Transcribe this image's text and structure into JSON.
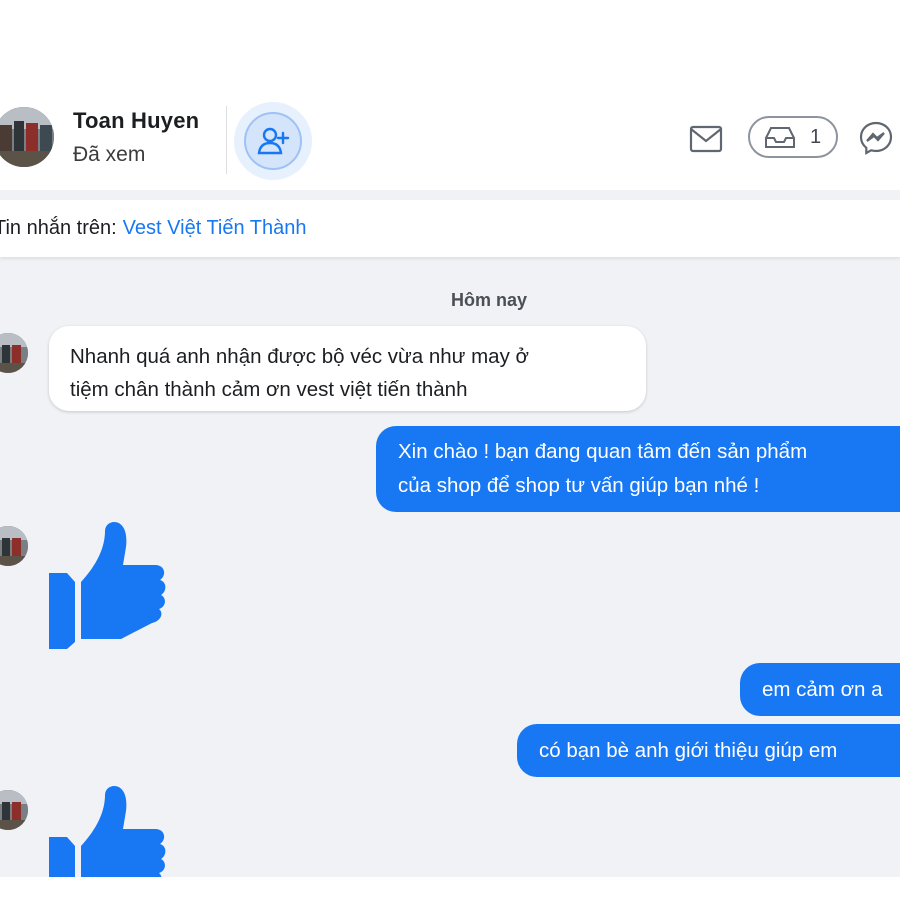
{
  "header": {
    "contact_name": "Toan Huyen",
    "status": "Đã xem",
    "inbox_count": "1"
  },
  "source": {
    "label": "Tin nhắn trên:",
    "page_name": "Vest Việt Tiến Thành"
  },
  "thread": {
    "day_separator": "Hôm nay",
    "messages": [
      {
        "from": "customer",
        "lines": [
          "Nhanh quá anh nhận được bộ véc vừa như may ở",
          "tiệm chân thành cảm ơn vest việt tiến thành"
        ]
      },
      {
        "from": "page",
        "lines": [
          "Xin chào ! bạn đang quan tâm đến sản phẩm",
          "của shop để shop tư vấn giúp bạn nhé !"
        ]
      },
      {
        "from": "customer",
        "sticker": "thumbs-up-icon"
      },
      {
        "from": "page",
        "lines": [
          "em cảm ơn a"
        ]
      },
      {
        "from": "page",
        "lines": [
          "có bạn bè anh giới thiệu giúp em"
        ]
      },
      {
        "from": "customer",
        "sticker": "thumbs-up-icon"
      }
    ]
  },
  "colors": {
    "accent": "#1877f2",
    "thread_bg": "#f0f2f5",
    "bubble_in": "#ffffff"
  }
}
